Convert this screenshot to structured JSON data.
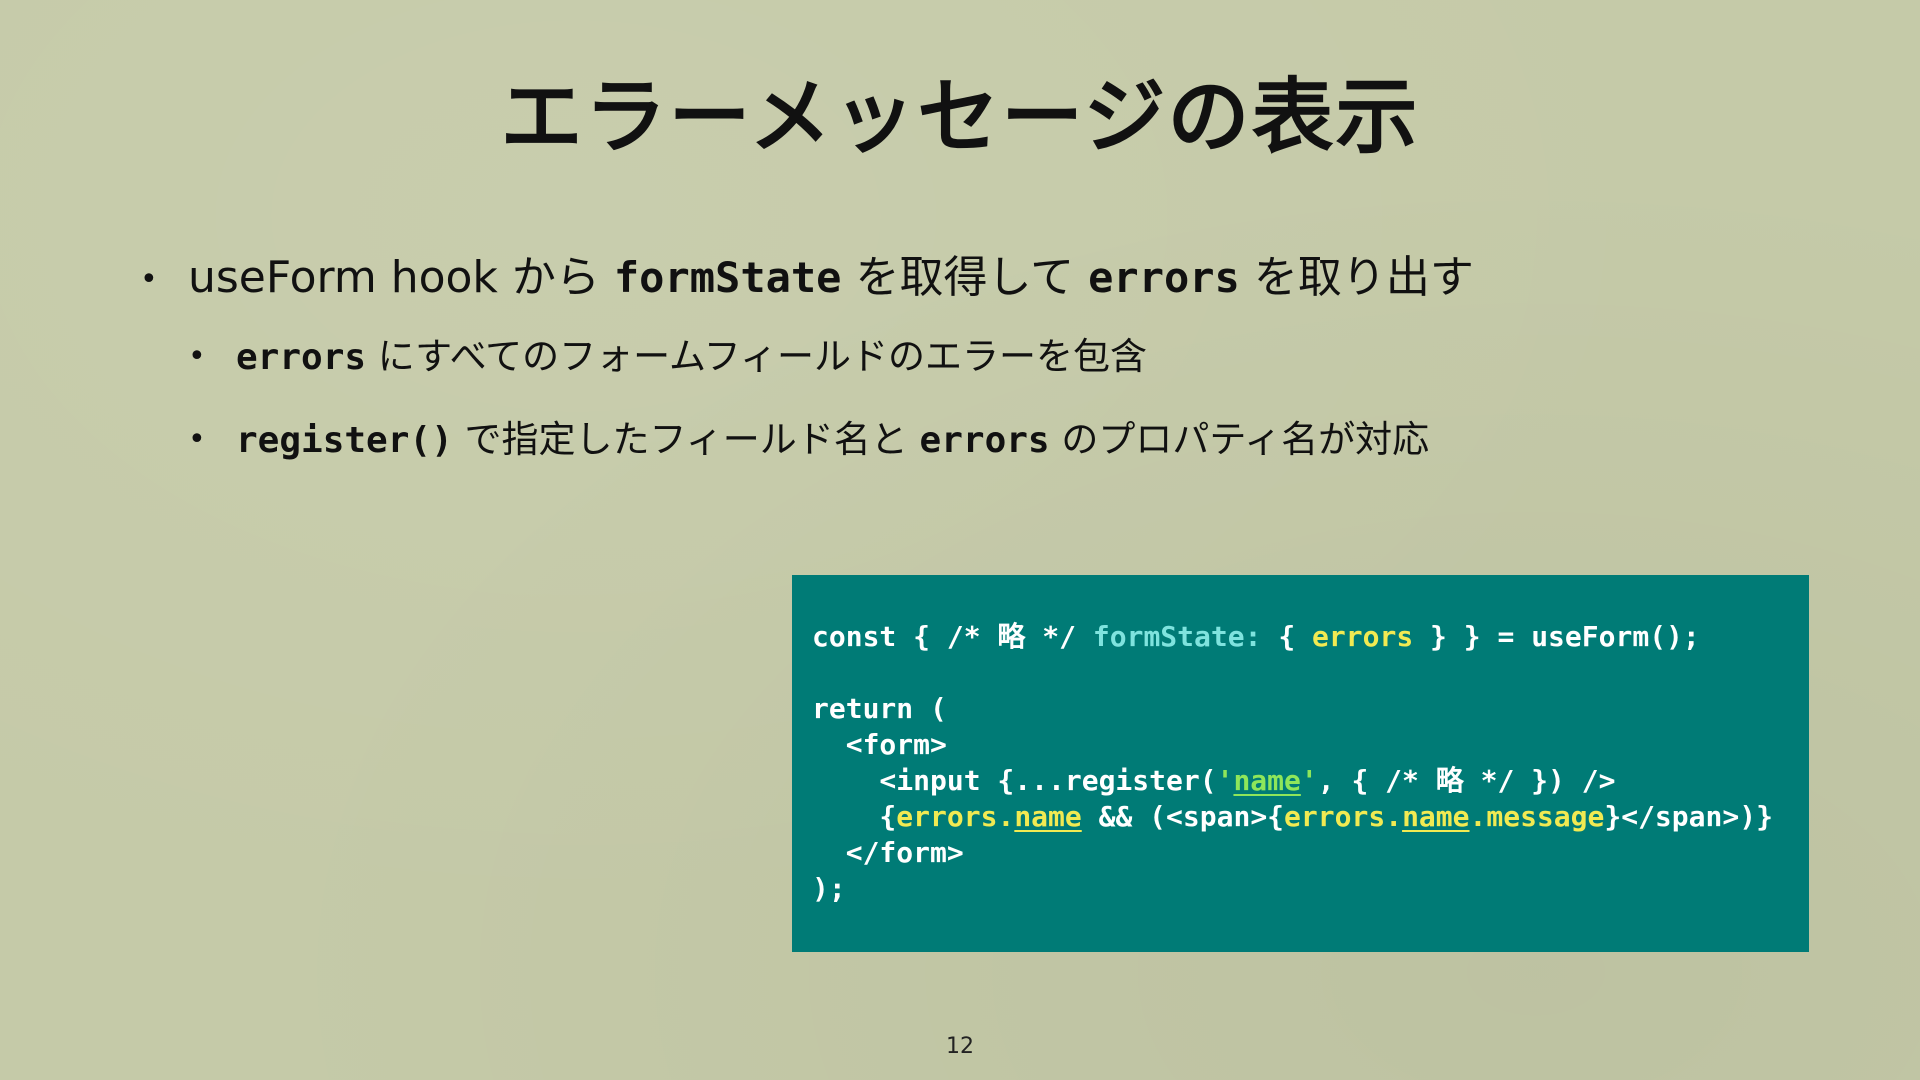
{
  "slide": {
    "title": "エラーメッセージの表示",
    "page_number": "12"
  },
  "bullets": {
    "b1": {
      "dot": "•",
      "text1": "useForm hook から ",
      "code1": "formState",
      "text2": " を取得して ",
      "code2": "errors",
      "text3": " を取り出す"
    },
    "b2": {
      "dot": "•",
      "code1": "errors",
      "text1": " にすべてのフォームフィールドのエラーを包含"
    },
    "b3": {
      "dot": "•",
      "code1": "register()",
      "text1": " で指定したフィールド名と ",
      "code2": "errors",
      "text2": " のプロパティ名が対応"
    }
  },
  "code": {
    "l1a": "const { /* 略 */ ",
    "l1b": "formState: ",
    "l1c": "{ ",
    "l1d": "errors",
    "l1e": " } } = useForm();",
    "l3": "return (",
    "l4": "  <form>",
    "l5a": "    <input {...register(",
    "l5b": "'",
    "l5c": "name",
    "l5d": "'",
    "l5e": ", { /* 略 */ }) />",
    "l6a": "    {",
    "l6b": "errors.",
    "l6c": "name",
    "l6d": " && (<span>{",
    "l6e": "errors.",
    "l6f": "name",
    "l6g": ".message",
    "l6h": "}</span>)}",
    "l7": "  </form>",
    "l8": ");"
  },
  "colors": {
    "background": "#c5caa8",
    "code_background": "#007b76",
    "code_text": "#ffffff",
    "code_cyan": "#7fe3de",
    "code_yellow": "#f1ea52",
    "code_green": "#8ee65a"
  }
}
